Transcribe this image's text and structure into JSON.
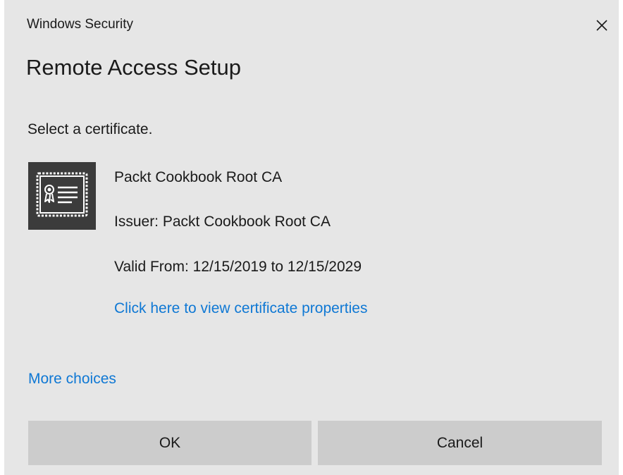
{
  "window": {
    "title": "Windows Security",
    "close_icon": "close-icon"
  },
  "dialog": {
    "heading": "Remote Access Setup",
    "prompt": "Select a certificate."
  },
  "certificate": {
    "icon": "certificate-icon",
    "name": "Packt Cookbook Root CA",
    "issuer": "Issuer: Packt Cookbook Root CA",
    "validity": "Valid From: 12/15/2019 to 12/15/2029",
    "properties_link": "Click here to view certificate properties"
  },
  "more_choices": "More choices",
  "buttons": {
    "ok": "OK",
    "cancel": "Cancel"
  },
  "colors": {
    "background": "#e6e6e6",
    "link": "#0f78d4",
    "button": "#cccccc",
    "icon_bg": "#3b3b3b"
  }
}
